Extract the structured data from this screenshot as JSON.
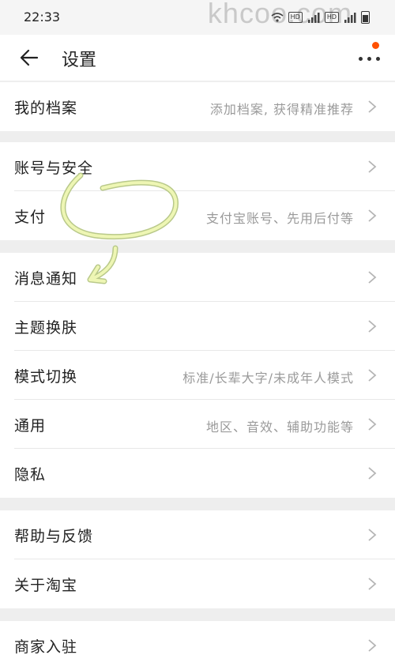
{
  "status_bar": {
    "time": "22:33",
    "icons": [
      "wifi-icon",
      "hd-badge",
      "signal-icon",
      "battery-icon"
    ]
  },
  "watermark": "khcoo.com",
  "header": {
    "title": "设置",
    "back_icon": "arrow-left-icon",
    "more_icon": "more-dots-icon"
  },
  "colors": {
    "accent": "#ff5000",
    "highlight_stroke": "#e8f2a0",
    "background": "#eeeeee"
  },
  "sections": [
    [
      {
        "label": "我的档案",
        "desc": "添加档案, 获得精准推荐"
      }
    ],
    [
      {
        "label": "账号与安全",
        "desc": ""
      },
      {
        "label": "支付",
        "desc": "支付宝账号、先用后付等"
      }
    ],
    [
      {
        "label": "消息通知",
        "desc": ""
      },
      {
        "label": "主题换肤",
        "desc": ""
      },
      {
        "label": "模式切换",
        "desc": "标准/长辈大字/未成年人模式"
      },
      {
        "label": "通用",
        "desc": "地区、音效、辅助功能等"
      },
      {
        "label": "隐私",
        "desc": ""
      }
    ],
    [
      {
        "label": "帮助与反馈",
        "desc": ""
      },
      {
        "label": "关于淘宝",
        "desc": ""
      }
    ],
    [
      {
        "label": "商家入驻",
        "desc": ""
      }
    ]
  ]
}
